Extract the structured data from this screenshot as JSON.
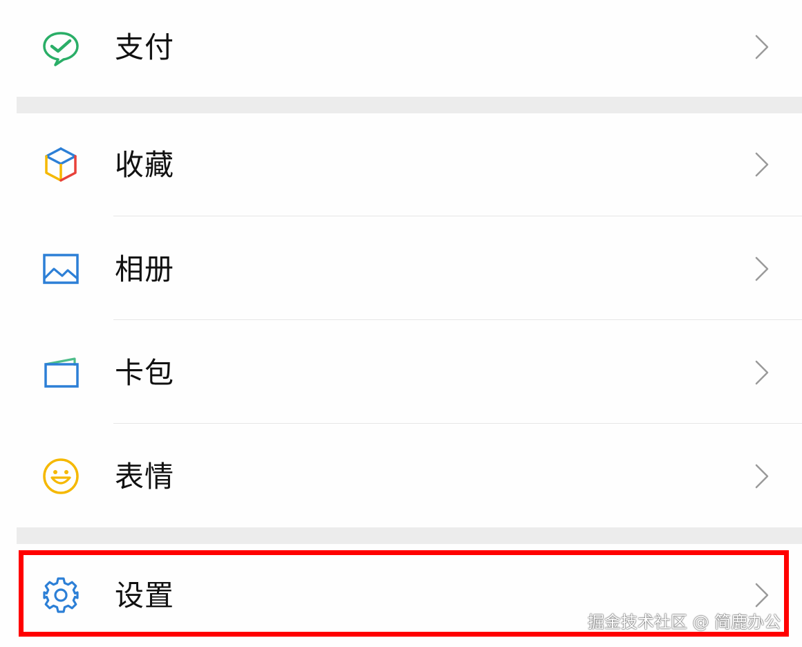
{
  "menu": {
    "items": [
      {
        "key": "pay",
        "label": "支付",
        "icon": "wechat-pay-icon"
      },
      {
        "key": "favorites",
        "label": "收藏",
        "icon": "favorites-cube-icon"
      },
      {
        "key": "album",
        "label": "相册",
        "icon": "album-picture-icon"
      },
      {
        "key": "cards",
        "label": "卡包",
        "icon": "card-wallet-icon"
      },
      {
        "key": "stickers",
        "label": "表情",
        "icon": "smiley-face-icon"
      },
      {
        "key": "settings",
        "label": "设置",
        "icon": "gear-icon"
      }
    ]
  },
  "watermark": "掘金技术社区 @ 简鹿办公",
  "colors": {
    "highlight": "#ff0000",
    "pay_green": "#2aae67",
    "album_blue": "#2c7fd6",
    "settings_blue": "#2c7fd6",
    "smiley_yellow": "#f5b800",
    "section_gap": "#ececec"
  }
}
